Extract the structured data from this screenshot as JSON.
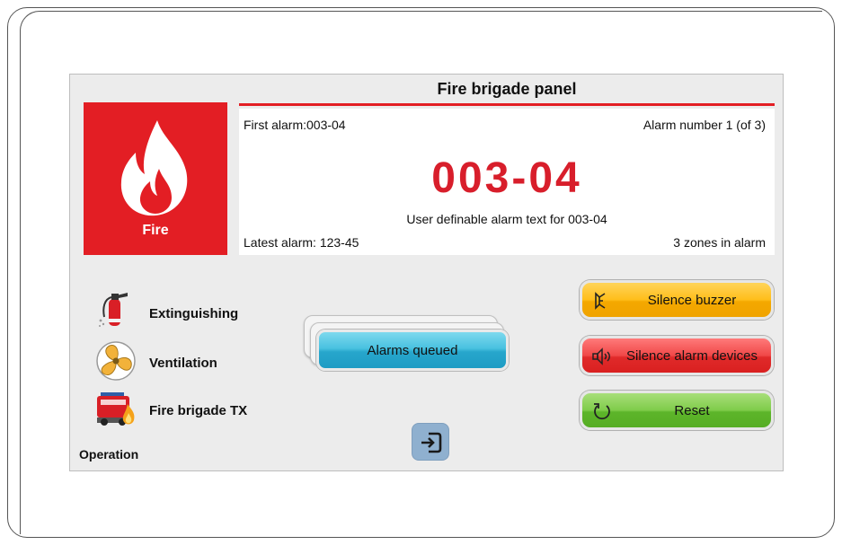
{
  "panel": {
    "title": "Fire brigade panel"
  },
  "fire_tile": {
    "label": "Fire",
    "color": "#e31e24"
  },
  "alarm_info": {
    "first_alarm": "First alarm:003-04",
    "alarm_number": "Alarm number 1 (of 3)",
    "alarm_id": "003-04",
    "alarm_text": "User definable alarm text for 003-04",
    "latest_alarm": "Latest alarm: 123-45",
    "zones": "3 zones in alarm",
    "alarm_id_color": "#d81e2b"
  },
  "status_items": [
    {
      "label": "Extinguishing",
      "icon": "fire-extinguisher-icon"
    },
    {
      "label": "Ventilation",
      "icon": "fan-icon"
    },
    {
      "label": "Fire brigade TX",
      "icon": "fire-truck-icon"
    }
  ],
  "operation_label": "Operation",
  "queue_button": {
    "label": "Alarms queued"
  },
  "actions": {
    "silence_buzzer": {
      "label": "Silence buzzer",
      "icon": "buzzer-icon",
      "color": "#ffbe1a"
    },
    "silence_alarm_devices": {
      "label": "Silence alarm devices",
      "icon": "speaker-icon",
      "color": "#f04848"
    },
    "reset": {
      "label": "Reset",
      "icon": "reset-icon",
      "color": "#7fcc4a"
    }
  },
  "exit_button": {
    "icon": "exit-icon"
  }
}
